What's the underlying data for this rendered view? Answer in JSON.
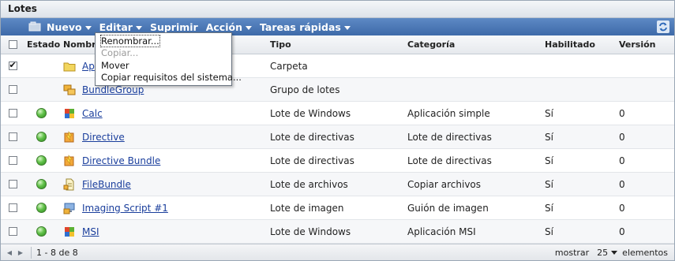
{
  "panel": {
    "title": "Lotes"
  },
  "toolbar": {
    "menus": [
      {
        "label": "Nuevo"
      },
      {
        "label": "Editar"
      },
      {
        "label": "Suprimir"
      },
      {
        "label": "Acción"
      },
      {
        "label": "Tareas rápidas"
      }
    ]
  },
  "edit_menu": {
    "items": [
      {
        "label": "Renombrar...",
        "enabled": true
      },
      {
        "label": "Copiar...",
        "enabled": false
      },
      {
        "label": "Mover",
        "enabled": true
      },
      {
        "label": "Copiar requisitos del sistema...",
        "enabled": true
      }
    ]
  },
  "columns": {
    "estado": "Estado",
    "nombre": "Nombre",
    "tipo": "Tipo",
    "categoria": "Categoría",
    "habilitado": "Habilitado",
    "version": "Versión"
  },
  "rows": [
    {
      "checked": true,
      "status": "",
      "name": "Ap",
      "tipo": "Carpeta",
      "categoria": "",
      "habilitado": "",
      "version": "",
      "icon": "folder-icon"
    },
    {
      "checked": false,
      "status": "",
      "name": "BundleGroup",
      "tipo": "Grupo de lotes",
      "categoria": "",
      "habilitado": "",
      "version": "",
      "icon": "bundle-group-icon"
    },
    {
      "checked": false,
      "status": "ok",
      "name": "Calc",
      "tipo": "Lote de Windows",
      "categoria": "Aplicación simple",
      "habilitado": "Sí",
      "version": "0",
      "icon": "windows-bundle-icon"
    },
    {
      "checked": false,
      "status": "ok",
      "name": "Directive",
      "tipo": "Lote de directivas",
      "categoria": "Lote de directivas",
      "habilitado": "Sí",
      "version": "0",
      "icon": "directive-bundle-icon"
    },
    {
      "checked": false,
      "status": "ok",
      "name": "Directive Bundle",
      "tipo": "Lote de directivas",
      "categoria": "Lote de directivas",
      "habilitado": "Sí",
      "version": "0",
      "icon": "directive-bundle-icon"
    },
    {
      "checked": false,
      "status": "ok",
      "name": "FileBundle",
      "tipo": "Lote de archivos",
      "categoria": "Copiar archivos",
      "habilitado": "Sí",
      "version": "0",
      "icon": "file-bundle-icon"
    },
    {
      "checked": false,
      "status": "ok",
      "name": "Imaging Script #1",
      "tipo": "Lote de imagen",
      "categoria": "Guión de imagen",
      "habilitado": "Sí",
      "version": "0",
      "icon": "imaging-bundle-icon"
    },
    {
      "checked": false,
      "status": "ok",
      "name": "MSI",
      "tipo": "Lote de Windows",
      "categoria": "Aplicación MSI",
      "habilitado": "Sí",
      "version": "0",
      "icon": "windows-bundle-icon"
    }
  ],
  "footer": {
    "range": "1 - 8 de 8",
    "show_label": "mostrar",
    "page_size": "25",
    "items_label": "elementos"
  },
  "colors": {
    "toolbar": "#4a76b5",
    "link": "#1a3e9c",
    "status_ok": "#4fb53a"
  }
}
